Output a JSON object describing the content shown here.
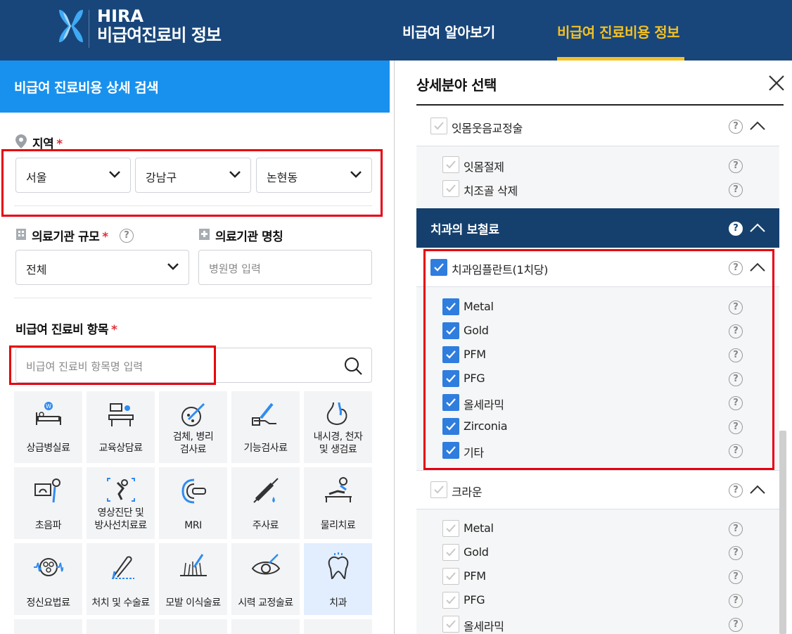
{
  "header": {
    "logo_title": "HIRA",
    "logo_sub": "비급여진료비 정보",
    "nav": [
      {
        "label": "비급여 알아보기",
        "active": false
      },
      {
        "label": "비급여 진료비용 정보",
        "active": true
      }
    ]
  },
  "left": {
    "title": "비급여 진료비용 상세 검색",
    "region_label": "지역",
    "required_mark": "*",
    "region_selects": [
      "서울",
      "강남구",
      "논현동"
    ],
    "scale_label": "의료기관 규모",
    "scale_value": "전체",
    "name_label": "의료기관 명칭",
    "name_placeholder": "병원명 입력",
    "item_label": "비급여 진료비 항목",
    "item_placeholder": "비급여 진료비 항목명 입력",
    "grid": [
      {
        "label": "상급병실료",
        "icon": "bed-icon"
      },
      {
        "label": "교육상담료",
        "icon": "consult-icon"
      },
      {
        "label": "검체, 병리\n검사료",
        "icon": "pathology-icon"
      },
      {
        "label": "기능검사료",
        "icon": "function-test-icon"
      },
      {
        "label": "내시경, 천자\n및 생검료",
        "icon": "endoscope-icon"
      },
      {
        "label": "초음파",
        "icon": "ultrasound-icon"
      },
      {
        "label": "영상진단 및\n방사선치료료",
        "icon": "xray-icon"
      },
      {
        "label": "MRI",
        "icon": "mri-icon"
      },
      {
        "label": "주사료",
        "icon": "syringe-icon"
      },
      {
        "label": "물리치료",
        "icon": "physio-icon"
      },
      {
        "label": "정신요법료",
        "icon": "brain-icon"
      },
      {
        "label": "처치 및 수술료",
        "icon": "surgery-icon"
      },
      {
        "label": "모발 이식술료",
        "icon": "hair-icon"
      },
      {
        "label": "시력 교정술료",
        "icon": "eye-icon"
      },
      {
        "label": "치과",
        "icon": "tooth-icon"
      }
    ]
  },
  "right": {
    "title": "상세분야 선택",
    "groups": [
      {
        "label": "잇몸웃음교정술",
        "checked": false,
        "items": [
          {
            "label": "잇몸절제",
            "checked": false
          },
          {
            "label": "치조골 삭제",
            "checked": false
          }
        ]
      },
      {
        "section": "치과의 보철료"
      },
      {
        "label": "치과임플란트(1치당)",
        "checked": true,
        "items": [
          {
            "label": "Metal",
            "checked": true
          },
          {
            "label": "Gold",
            "checked": true
          },
          {
            "label": "PFM",
            "checked": true
          },
          {
            "label": "PFG",
            "checked": true
          },
          {
            "label": "올세라믹",
            "checked": true
          },
          {
            "label": "Zirconia",
            "checked": true
          },
          {
            "label": "기타",
            "checked": true
          }
        ]
      },
      {
        "label": "크라운",
        "checked": false,
        "items": [
          {
            "label": "Metal",
            "checked": false
          },
          {
            "label": "Gold",
            "checked": false
          },
          {
            "label": "PFM",
            "checked": false
          },
          {
            "label": "PFG",
            "checked": false
          },
          {
            "label": "올세라믹",
            "checked": false
          }
        ]
      }
    ],
    "help_glyph": "?"
  },
  "colors": {
    "header_bg": "#18467a",
    "accent_yellow": "#f4c023",
    "left_head_bg": "#1891ee",
    "section_bg": "#15406e",
    "check_blue": "#2f7dde",
    "highlight_red": "#e6000f"
  }
}
